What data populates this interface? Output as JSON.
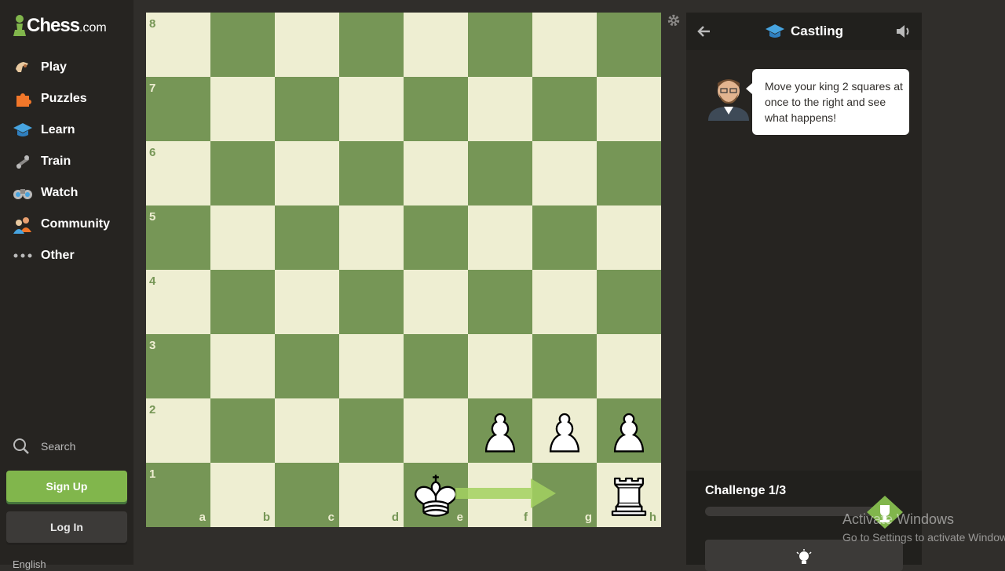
{
  "sidebar": {
    "logo_word": "Chess",
    "logo_tld": ".com",
    "items": [
      {
        "label": "Play",
        "icon": "play-hand-icon"
      },
      {
        "label": "Puzzles",
        "icon": "puzzle-piece-icon"
      },
      {
        "label": "Learn",
        "icon": "graduation-cap-icon"
      },
      {
        "label": "Train",
        "icon": "train-icon"
      },
      {
        "label": "Watch",
        "icon": "binoculars-icon"
      },
      {
        "label": "Community",
        "icon": "community-icon"
      },
      {
        "label": "Other",
        "icon": "more-dots-icon"
      }
    ],
    "search_label": "Search",
    "signup_label": "Sign Up",
    "login_label": "Log In",
    "language_label": "English"
  },
  "board": {
    "ranks": [
      "8",
      "7",
      "6",
      "5",
      "4",
      "3",
      "2",
      "1"
    ],
    "files": [
      "a",
      "b",
      "c",
      "d",
      "e",
      "f",
      "g",
      "h"
    ],
    "pieces": [
      {
        "square": "f2",
        "piece": "white-pawn"
      },
      {
        "square": "g2",
        "piece": "white-pawn"
      },
      {
        "square": "h2",
        "piece": "white-pawn"
      },
      {
        "square": "e1",
        "piece": "white-king"
      },
      {
        "square": "h1",
        "piece": "white-rook"
      }
    ],
    "arrow": {
      "from": "e1",
      "to": "g1"
    },
    "colors": {
      "light": "#eeeed2",
      "dark": "#769656",
      "arrow": "#a3d160"
    }
  },
  "panel": {
    "title": "Castling",
    "coach_message": "Move your king 2 squares at once to the right and see what happens!",
    "challenge_label": "Challenge 1/3",
    "progress": 0
  },
  "watermark": {
    "line1": "Activate Windows",
    "line2": "Go to Settings to activate Windows."
  }
}
